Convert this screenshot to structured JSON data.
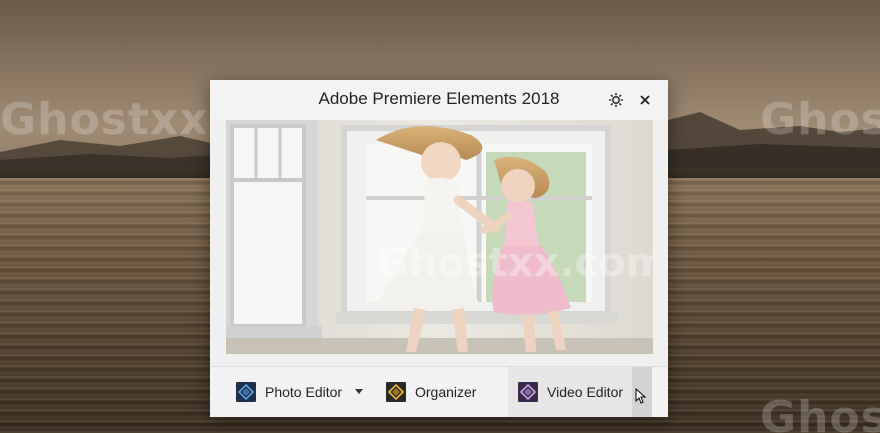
{
  "window": {
    "title": "Adobe Premiere Elements 2018"
  },
  "watermark": {
    "text_left": "Ghostxx.com",
    "text_center": "Ghostxx.com",
    "text_right_top": "Ghos",
    "text_right_bottom": "Ghos"
  },
  "apps": {
    "photo_editor_label": "Photo Editor",
    "organizer_label": "Organizer",
    "video_editor_label": "Video Editor"
  },
  "icons": {
    "settings": "gear-icon",
    "close": "close-icon",
    "photo_editor": "photo-editor-icon",
    "organizer": "organizer-icon",
    "video_editor": "video-editor-icon",
    "dropdown": "caret-down-icon"
  },
  "colors": {
    "photo_editor_icon_bg": "#1f2f4a",
    "photo_editor_icon_accent": "#5aa0e6",
    "organizer_icon_bg": "#2c2a26",
    "organizer_icon_accent": "#f0b429",
    "video_editor_icon_bg": "#3a2a4a",
    "video_editor_icon_accent": "#c9a0f0"
  }
}
